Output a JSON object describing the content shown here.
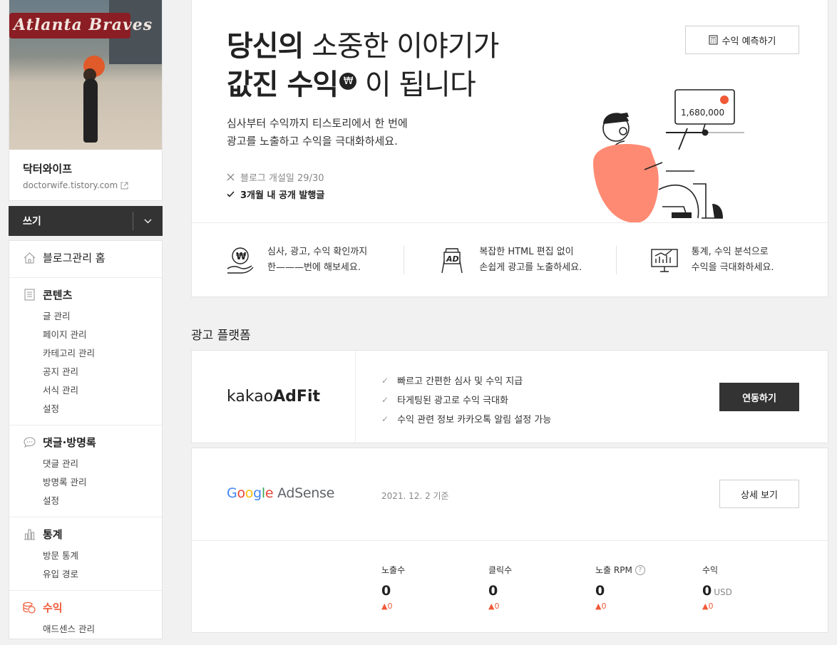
{
  "profile": {
    "photo_text": "Atlanta Braves",
    "name": "닥터와이프",
    "url": "doctorwife.tistory.com"
  },
  "write_button": {
    "label": "쓰기"
  },
  "menu": {
    "home": "블로그관리 홈",
    "contents": {
      "title": "콘텐츠",
      "items": [
        "글 관리",
        "페이지 관리",
        "카테고리 관리",
        "공지 관리",
        "서식 관리",
        "설정"
      ]
    },
    "comments": {
      "title": "댓글·방명록",
      "items": [
        "댓글 관리",
        "방명록 관리",
        "설정"
      ]
    },
    "stats": {
      "title": "통계",
      "items": [
        "방문 통계",
        "유입 경로"
      ]
    },
    "revenue": {
      "title": "수익",
      "items": [
        "애드센스 관리"
      ]
    }
  },
  "hero": {
    "title_line1_bold": "당신의",
    "title_line1_light": " 소중한 이야기가",
    "title_line2_bold": "값진 수익",
    "title_line2_light": " 이 됩니다",
    "won_symbol": "₩",
    "desc_line1": "심사부터 수익까지 티스토리에서 한 번에",
    "desc_line2": "광고를 노출하고 수익을 극대화하세요.",
    "req_fail": "블로그 개설일 29/30",
    "req_pass": "3개월 내 공개 발행글",
    "predict_button": "수익 예측하기",
    "illus_amount": "1,680,000"
  },
  "features": [
    {
      "line1": "심사, 광고, 수익 확인까지",
      "line2": "한———번에 해보세요.",
      "icon": "won-hand-icon"
    },
    {
      "line1": "복잡한 HTML 편집 없이",
      "line2": "손쉽게 광고를 노출하세요.",
      "icon": "ad-board-icon"
    },
    {
      "line1": "통계, 수익 분석으로",
      "line2": "수익을 극대화하세요.",
      "icon": "monitor-chart-icon"
    }
  ],
  "ad_platform": {
    "section_title": "광고 플랫폼",
    "adfit": {
      "logo_light": "kakao",
      "logo_bold": "AdFit",
      "bullets": [
        "빠르고 간편한 심사 및 수익 지급",
        "타게팅된 광고로 수익 극대화",
        "수익 관련 정보 카카오톡 알림 설정 가능"
      ],
      "connect_button": "연동하기"
    },
    "adsense": {
      "logo_g": "G",
      "logo_o1": "o",
      "logo_o2": "o",
      "logo_g2": "g",
      "logo_l": "l",
      "logo_e": "e",
      "logo_rest": " AdSense",
      "date": "2021. 12. 2 기준",
      "detail_button": "상세 보기",
      "stats": [
        {
          "label": "노출수",
          "value": "0",
          "unit": "",
          "delta": "▲0"
        },
        {
          "label": "클릭수",
          "value": "0",
          "unit": "",
          "delta": "▲0"
        },
        {
          "label": "노출 RPM",
          "value": "0",
          "unit": "",
          "delta": "▲0",
          "help": "?"
        },
        {
          "label": "수익",
          "value": "0",
          "unit": "USD",
          "delta": "▲0"
        }
      ]
    }
  },
  "colors": {
    "accent": "#f05a38",
    "dark_button": "#333333",
    "illustration_skin": "#ff8a73"
  }
}
